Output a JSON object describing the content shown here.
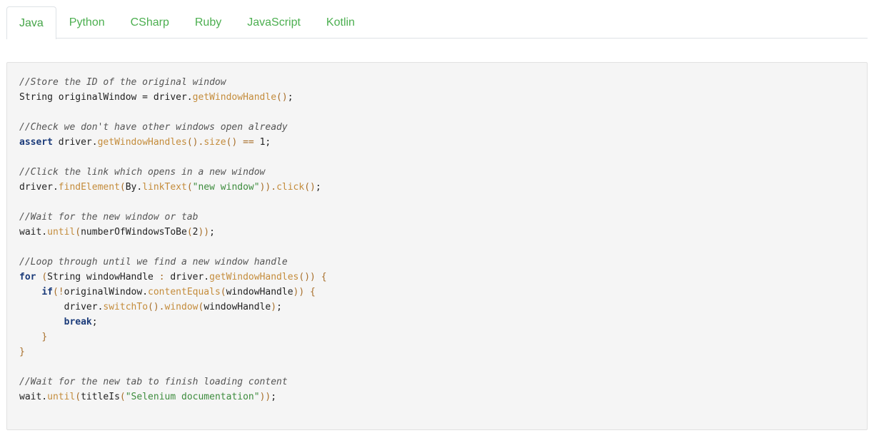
{
  "tabs": [
    {
      "label": "Java",
      "active": true
    },
    {
      "label": "Python",
      "active": false
    },
    {
      "label": "CSharp",
      "active": false
    },
    {
      "label": "Ruby",
      "active": false
    },
    {
      "label": "JavaScript",
      "active": false
    },
    {
      "label": "Kotlin",
      "active": false
    }
  ],
  "colors": {
    "tab_text": "#4caf50",
    "code_background": "#f5f5f5",
    "comment": "#555555",
    "keyword": "#1b3b7a",
    "method": "#c48c3b",
    "string": "#3d8c3d"
  },
  "code": {
    "language": "Java",
    "lines": [
      [
        {
          "t": "c",
          "v": "//Store the ID of the original window"
        }
      ],
      [
        {
          "t": "p",
          "v": "String originalWindow = driver."
        },
        {
          "t": "m",
          "v": "getWindowHandle"
        },
        {
          "t": "o",
          "v": "()"
        },
        {
          "t": "p",
          "v": ";"
        }
      ],
      [],
      [
        {
          "t": "c",
          "v": "//Check we don't have other windows open already"
        }
      ],
      [
        {
          "t": "k",
          "v": "assert"
        },
        {
          "t": "p",
          "v": " driver."
        },
        {
          "t": "m",
          "v": "getWindowHandles"
        },
        {
          "t": "o",
          "v": "()."
        },
        {
          "t": "m",
          "v": "size"
        },
        {
          "t": "o",
          "v": "()"
        },
        {
          "t": "p",
          "v": " "
        },
        {
          "t": "o",
          "v": "=="
        },
        {
          "t": "p",
          "v": " 1;"
        }
      ],
      [],
      [
        {
          "t": "c",
          "v": "//Click the link which opens in a new window"
        }
      ],
      [
        {
          "t": "p",
          "v": "driver."
        },
        {
          "t": "m",
          "v": "findElement"
        },
        {
          "t": "o",
          "v": "("
        },
        {
          "t": "p",
          "v": "By."
        },
        {
          "t": "m",
          "v": "linkText"
        },
        {
          "t": "o",
          "v": "("
        },
        {
          "t": "s",
          "v": "\"new window\""
        },
        {
          "t": "o",
          "v": "))."
        },
        {
          "t": "m",
          "v": "click"
        },
        {
          "t": "o",
          "v": "()"
        },
        {
          "t": "p",
          "v": ";"
        }
      ],
      [],
      [
        {
          "t": "c",
          "v": "//Wait for the new window or tab"
        }
      ],
      [
        {
          "t": "p",
          "v": "wait."
        },
        {
          "t": "m",
          "v": "until"
        },
        {
          "t": "o",
          "v": "("
        },
        {
          "t": "p",
          "v": "numberOfWindowsToBe"
        },
        {
          "t": "o",
          "v": "("
        },
        {
          "t": "p",
          "v": "2"
        },
        {
          "t": "o",
          "v": "))"
        },
        {
          "t": "p",
          "v": ";"
        }
      ],
      [],
      [
        {
          "t": "c",
          "v": "//Loop through until we find a new window handle"
        }
      ],
      [
        {
          "t": "k",
          "v": "for"
        },
        {
          "t": "p",
          "v": " "
        },
        {
          "t": "o",
          "v": "("
        },
        {
          "t": "p",
          "v": "String windowHandle "
        },
        {
          "t": "o",
          "v": ":"
        },
        {
          "t": "p",
          "v": " driver."
        },
        {
          "t": "m",
          "v": "getWindowHandles"
        },
        {
          "t": "o",
          "v": "())"
        },
        {
          "t": "p",
          "v": " "
        },
        {
          "t": "o",
          "v": "{"
        }
      ],
      [
        {
          "t": "p",
          "v": "    "
        },
        {
          "t": "k",
          "v": "if"
        },
        {
          "t": "o",
          "v": "(!"
        },
        {
          "t": "p",
          "v": "originalWindow."
        },
        {
          "t": "m",
          "v": "contentEquals"
        },
        {
          "t": "o",
          "v": "("
        },
        {
          "t": "p",
          "v": "windowHandle"
        },
        {
          "t": "o",
          "v": "))"
        },
        {
          "t": "p",
          "v": " "
        },
        {
          "t": "o",
          "v": "{"
        }
      ],
      [
        {
          "t": "p",
          "v": "        driver."
        },
        {
          "t": "m",
          "v": "switchTo"
        },
        {
          "t": "o",
          "v": "()."
        },
        {
          "t": "m",
          "v": "window"
        },
        {
          "t": "o",
          "v": "("
        },
        {
          "t": "p",
          "v": "windowHandle"
        },
        {
          "t": "o",
          "v": ")"
        },
        {
          "t": "p",
          "v": ";"
        }
      ],
      [
        {
          "t": "p",
          "v": "        "
        },
        {
          "t": "k",
          "v": "break"
        },
        {
          "t": "p",
          "v": ";"
        }
      ],
      [
        {
          "t": "p",
          "v": "    "
        },
        {
          "t": "o",
          "v": "}"
        }
      ],
      [
        {
          "t": "o",
          "v": "}"
        }
      ],
      [],
      [
        {
          "t": "c",
          "v": "//Wait for the new tab to finish loading content"
        }
      ],
      [
        {
          "t": "p",
          "v": "wait."
        },
        {
          "t": "m",
          "v": "until"
        },
        {
          "t": "o",
          "v": "("
        },
        {
          "t": "p",
          "v": "titleIs"
        },
        {
          "t": "o",
          "v": "("
        },
        {
          "t": "s",
          "v": "\"Selenium documentation\""
        },
        {
          "t": "o",
          "v": "))"
        },
        {
          "t": "p",
          "v": ";"
        }
      ]
    ]
  }
}
